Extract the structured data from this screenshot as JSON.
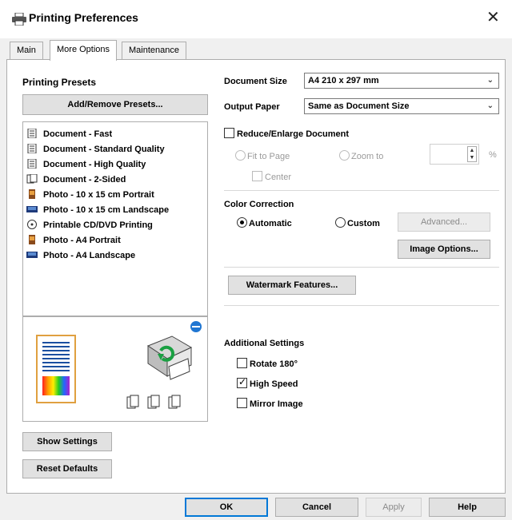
{
  "window": {
    "title": "Printing Preferences",
    "close_glyph": "✕"
  },
  "tabs": [
    {
      "label": "Main"
    },
    {
      "label": "More Options"
    },
    {
      "label": "Maintenance"
    }
  ],
  "presets": {
    "heading": "Printing Presets",
    "add_remove_label": "Add/Remove Presets...",
    "items": [
      "Document - Fast",
      "Document - Standard Quality",
      "Document - High Quality",
      "Document - 2-Sided",
      "Photo - 10 x 15 cm Portrait",
      "Photo - 10 x 15 cm Landscape",
      "Printable CD/DVD Printing",
      "Photo - A4 Portrait",
      "Photo - A4 Landscape"
    ]
  },
  "settings": {
    "document_size_label": "Document Size",
    "document_size_value": "A4 210 x 297 mm",
    "output_paper_label": "Output Paper",
    "output_paper_value": "Same as Document Size",
    "reduce_enlarge_label": "Reduce/Enlarge Document",
    "fit_to_page_label": "Fit to Page",
    "zoom_to_label": "Zoom to",
    "zoom_value": "",
    "percent_label": "%",
    "center_label": "Center",
    "color_correction_label": "Color Correction",
    "automatic_label": "Automatic",
    "custom_label": "Custom",
    "advanced_label": "Advanced...",
    "image_options_label": "Image Options...",
    "watermark_label": "Watermark Features...",
    "additional_settings_label": "Additional Settings",
    "rotate_label": "Rotate 180°",
    "high_speed_label": "High Speed",
    "mirror_label": "Mirror Image",
    "high_speed_checked": true
  },
  "left_buttons": {
    "show_settings": "Show Settings",
    "reset_defaults": "Reset Defaults"
  },
  "footer": {
    "ok": "OK",
    "cancel": "Cancel",
    "apply": "Apply",
    "help": "Help"
  },
  "colors": {
    "accent": "#0078d7",
    "border": "#adadad"
  }
}
